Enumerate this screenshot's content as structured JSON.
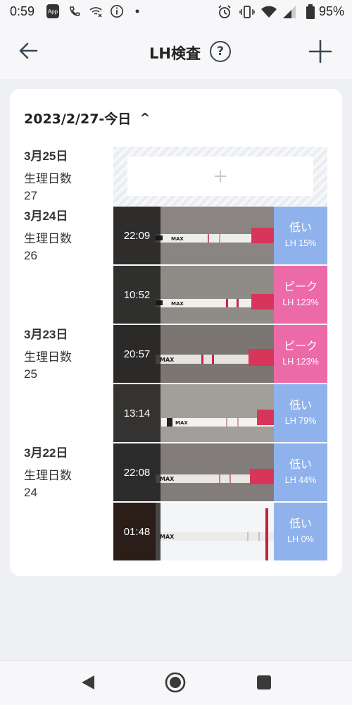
{
  "status": {
    "time": "0:59",
    "app_badge": "App",
    "battery": "95%"
  },
  "header": {
    "title": "LH検査",
    "help_glyph": "?"
  },
  "range": {
    "label": "2023/2/27-今日",
    "chevron": "^"
  },
  "days": [
    {
      "date": "3月25日",
      "cycle_label": "生理日数",
      "cycle_day": "27"
    },
    {
      "date": "3月24日",
      "cycle_label": "生理日数",
      "cycle_day": "26"
    },
    {
      "date": "3月23日",
      "cycle_label": "生理日数",
      "cycle_day": "25"
    },
    {
      "date": "3月22日",
      "cycle_label": "生理日数",
      "cycle_day": "24"
    }
  ],
  "add_slot": {
    "glyph": "+"
  },
  "tests": [
    {
      "time": "22:09",
      "level": "低い",
      "lh": "LH 15%",
      "status": "low",
      "lh_value": 15
    },
    {
      "time": "10:52",
      "level": "ピーク",
      "lh": "LH 123%",
      "status": "peak",
      "lh_value": 123
    },
    {
      "time": "20:57",
      "level": "ピーク",
      "lh": "LH 123%",
      "status": "peak",
      "lh_value": 123
    },
    {
      "time": "13:14",
      "level": "低い",
      "lh": "LH 79%",
      "status": "low",
      "lh_value": 79
    },
    {
      "time": "22:08",
      "level": "低い",
      "lh": "LH 44%",
      "status": "low",
      "lh_value": 44
    },
    {
      "time": "01:48",
      "level": "低い",
      "lh": "LH 0%",
      "status": "low",
      "lh_value": 0
    }
  ],
  "strip_text": "MAX",
  "colors": {
    "low": "#8fb2ec",
    "peak": "#ec6aa8",
    "background": "#eef0f4"
  },
  "icons": {
    "back": "arrow-left-icon",
    "help": "question-circle-icon",
    "add": "plus-icon",
    "nav_back": "triangle-back-icon",
    "nav_home": "circle-home-icon",
    "nav_recents": "square-recents-icon"
  }
}
